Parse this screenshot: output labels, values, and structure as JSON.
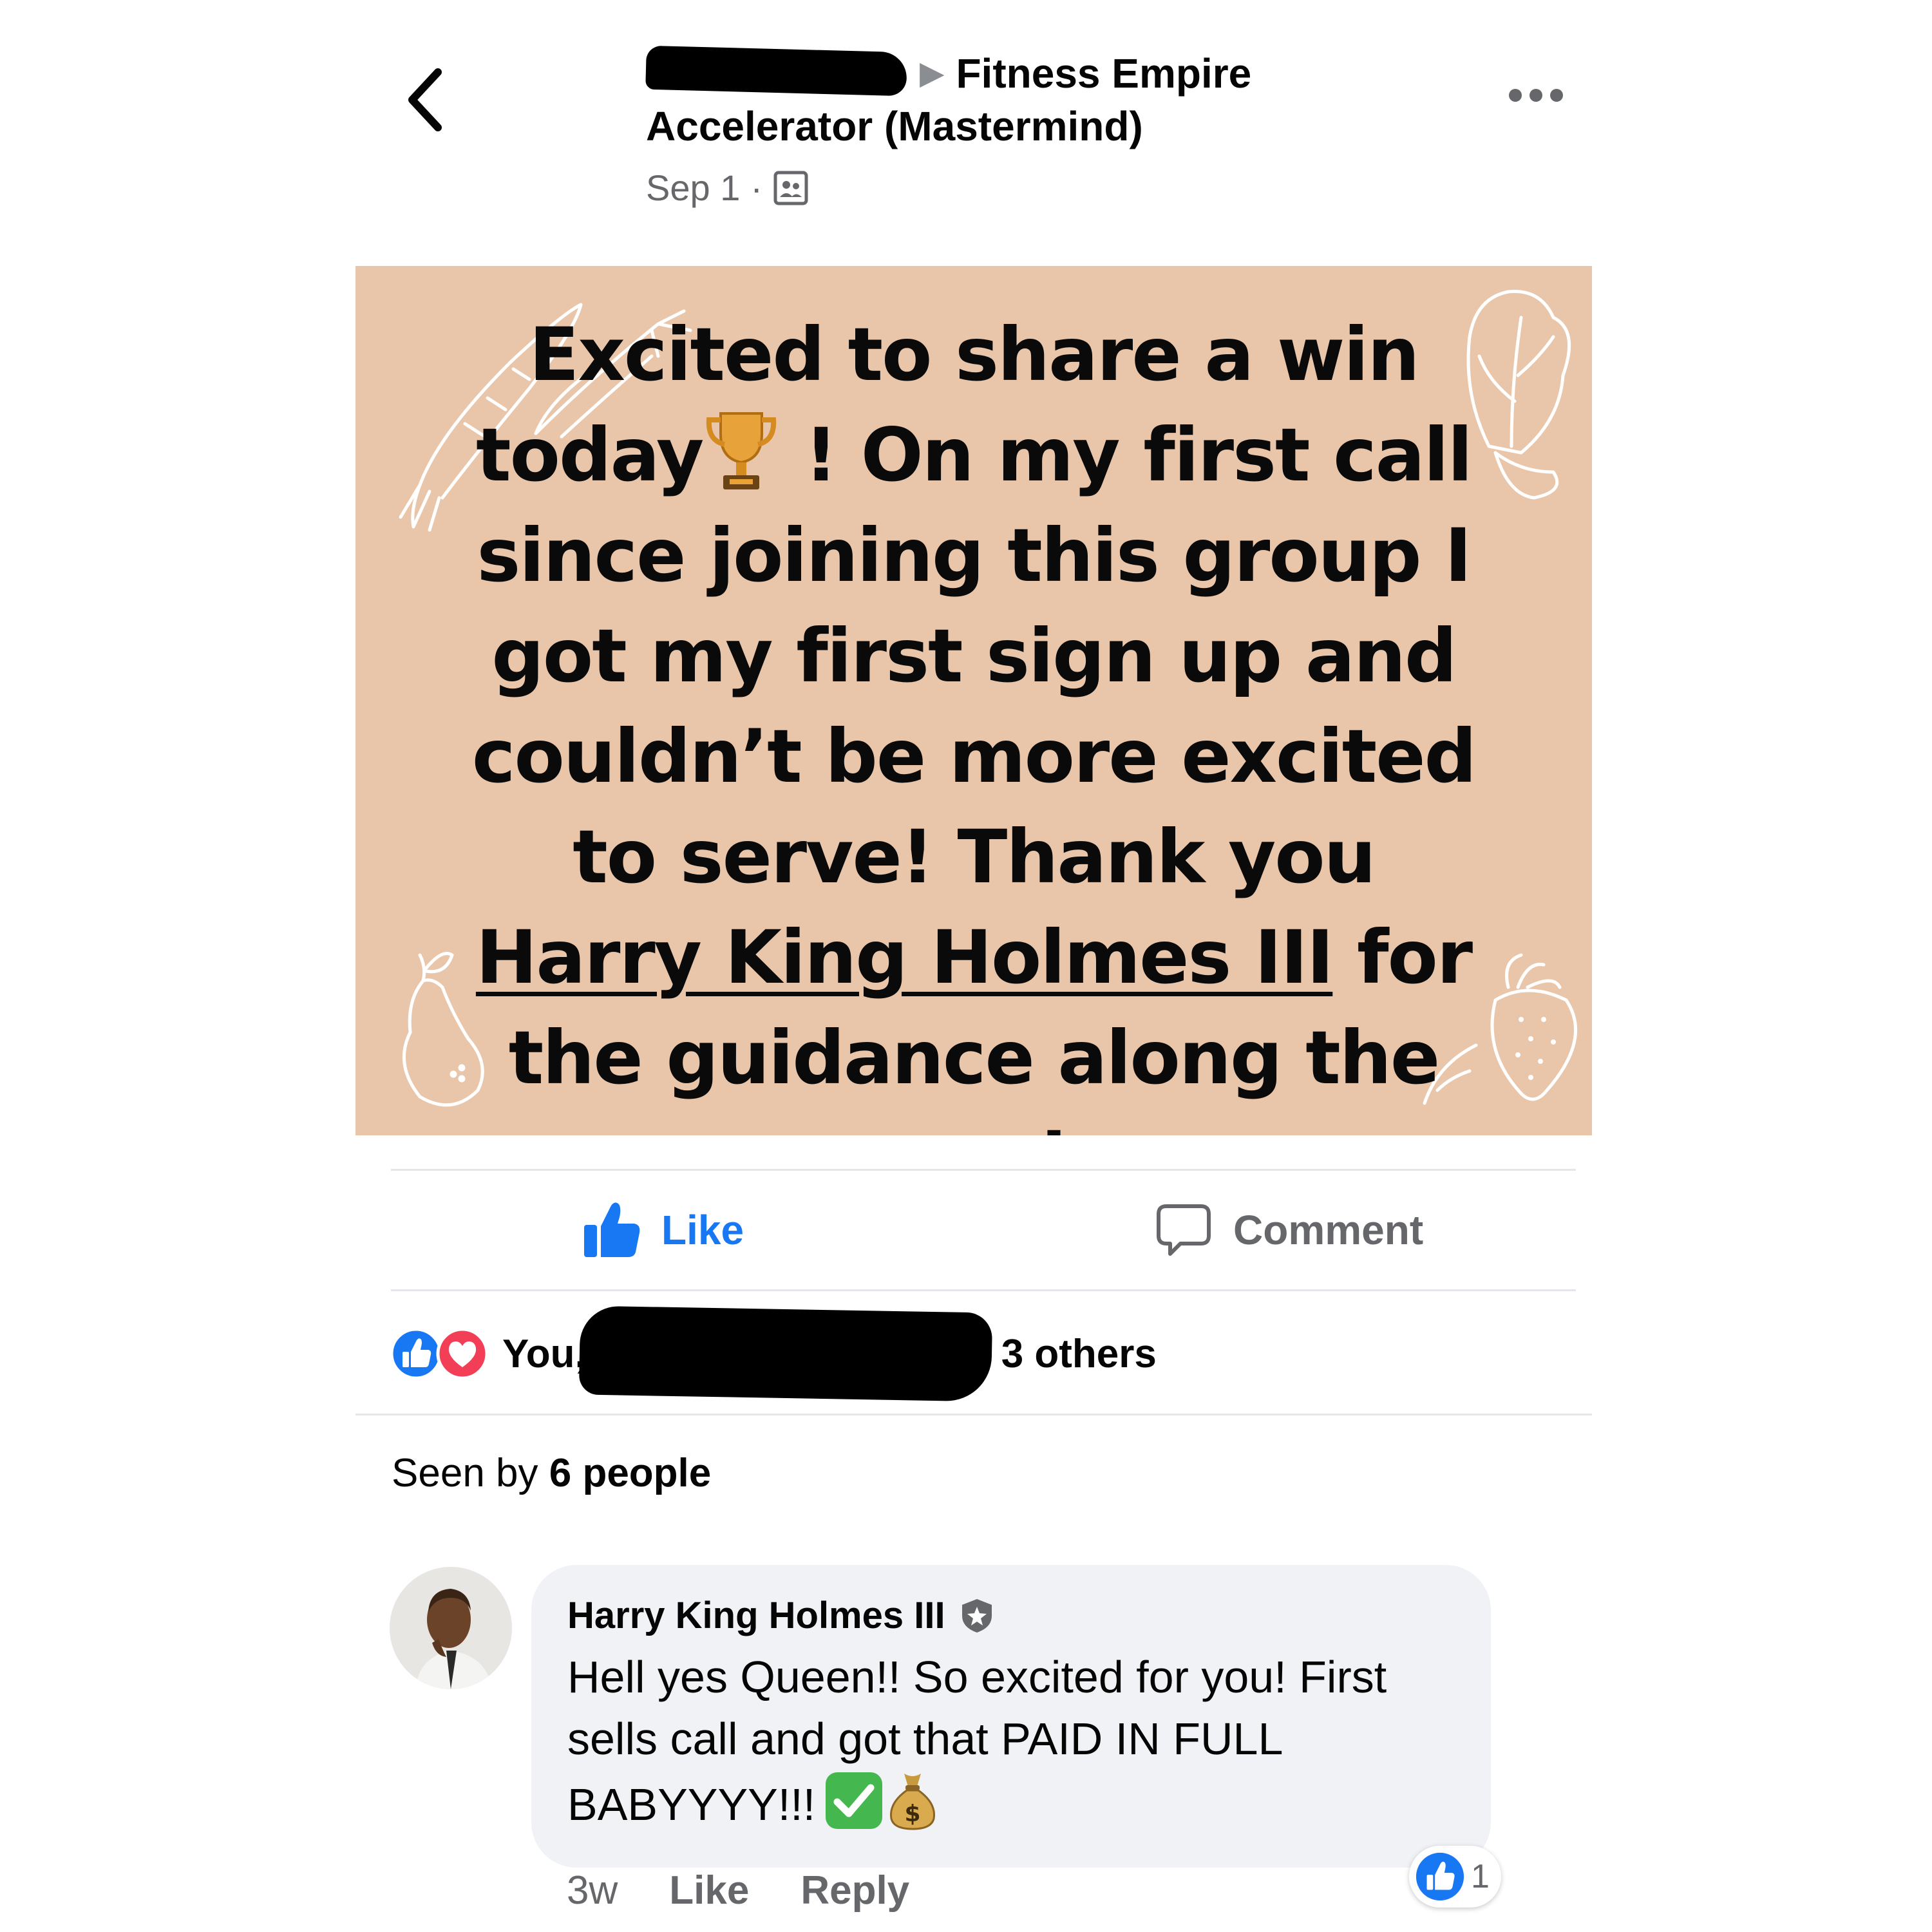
{
  "header": {
    "back_icon": "chevron-left-icon",
    "author_redacted": true,
    "breadcrumb_arrow": "▶",
    "group_name_line1": "Fitness Empire",
    "group_name_line2": "Accelerator (Mastermind)",
    "post_date": "Sep 1",
    "meta_separator": "·",
    "privacy_icon": "group-members-icon",
    "more_icon": "more-options-icon"
  },
  "post": {
    "background_color": "#e9c6aa",
    "text_before_trophy": "Excited to share a win today",
    "trophy_icon": "trophy-icon",
    "text_after_trophy": " ! On my first call since joining this group I got my first sign up and couldn’t be more excited to serve! Thank you ",
    "mention": "Harry King Holmes III",
    "text_after_mention": " for the guidance along the way!",
    "decorations": [
      "carrot-icon",
      "lettuce-icon",
      "pear-icon",
      "strawberry-icon"
    ]
  },
  "actions": {
    "like_label": "Like",
    "like_icon": "thumbs-up-icon",
    "comment_label": "Comment",
    "comment_icon": "speech-bubble-icon",
    "like_color": "#1877f2"
  },
  "reactions": {
    "icons": [
      "like-reaction-icon",
      "love-reaction-icon"
    ],
    "prefix": "You,",
    "names_redacted": true,
    "suffix": "nd 3 others"
  },
  "seen": {
    "prefix": "Seen by ",
    "count_text": "6 people"
  },
  "comment": {
    "author": "Harry King Holmes III",
    "badge_icon": "admin-shield-icon",
    "text": "Hell yes Queen!! So excited for you! First sells call and got that PAID IN FULL BABYYYY!!!",
    "emojis": [
      "check-mark-icon",
      "money-bag-icon"
    ],
    "time": "3w",
    "like_label": "Like",
    "reply_label": "Reply",
    "reaction_count": "1"
  }
}
